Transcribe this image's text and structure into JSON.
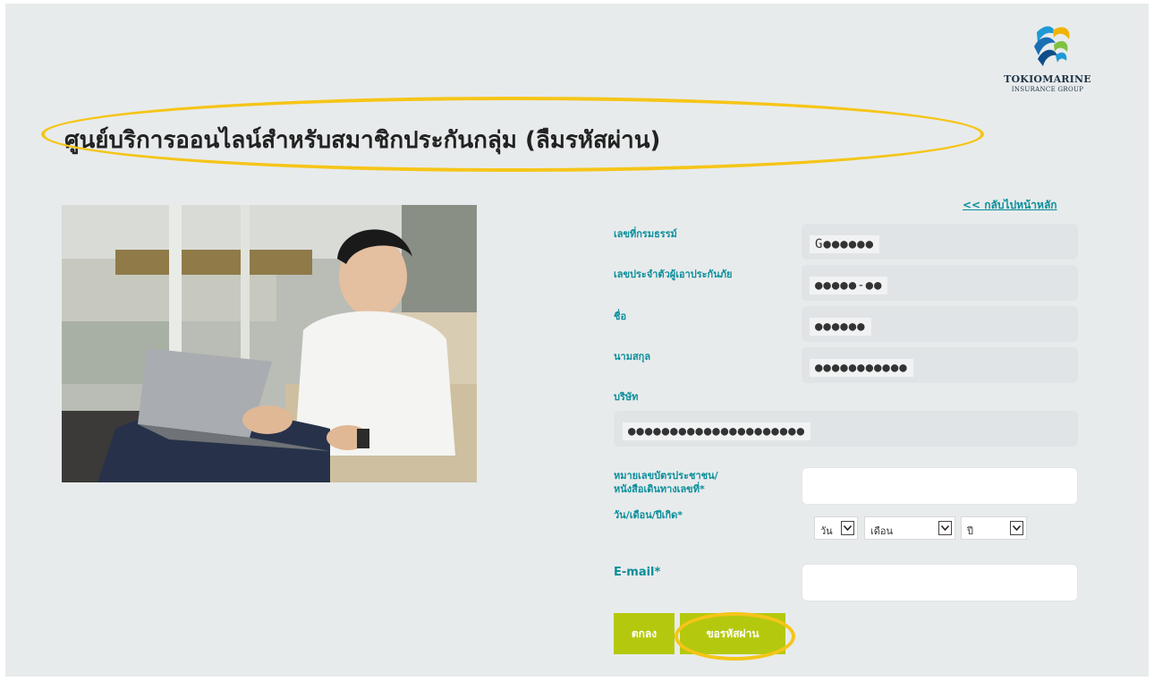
{
  "logo": {
    "line1": "TOKIOMARINE",
    "line2": "INSURANCE GROUP"
  },
  "page_title": "ศูนย์บริการออนไลน์สำหรับสมาชิกประกันกลุ่ม (ลืมรหัสผ่าน)",
  "back_link": "<< กลับไปหน้าหลัก",
  "form": {
    "policy_label": "เลขที่กรมธรรม์",
    "policy_value": "G●●●●●●",
    "insured_id_label": "เลขประจำตัวผู้เอาประกันภัย",
    "insured_id_value": "●●●●●-●●",
    "first_name_label": "ชื่อ",
    "first_name_value": "●●●●●●",
    "last_name_label": "นามสกุล",
    "last_name_value": "●●●●●●●●●●●",
    "company_label": "บริษัท",
    "company_value": "●●●●●●●●●●●●●●●●●●●●●",
    "id_card_label_1": "หมายเลขบัตรประชาชน/",
    "id_card_label_2": "หนังสือเดินทางเลขที่*",
    "id_card_value": "",
    "dob_label": "วัน/เดือน/ปีเกิด*",
    "day_selected": "วัน",
    "month_selected": "เดือน",
    "year_selected": "ปี",
    "email_label": "E-mail*",
    "email_value": ""
  },
  "buttons": {
    "ok": "ตกลง",
    "request_password": "ขอรหัสผ่าน"
  },
  "colors": {
    "teal": "#0a8f9b",
    "lime": "#b4c90e",
    "highlight": "#f5c518",
    "background": "#e8ebec"
  }
}
